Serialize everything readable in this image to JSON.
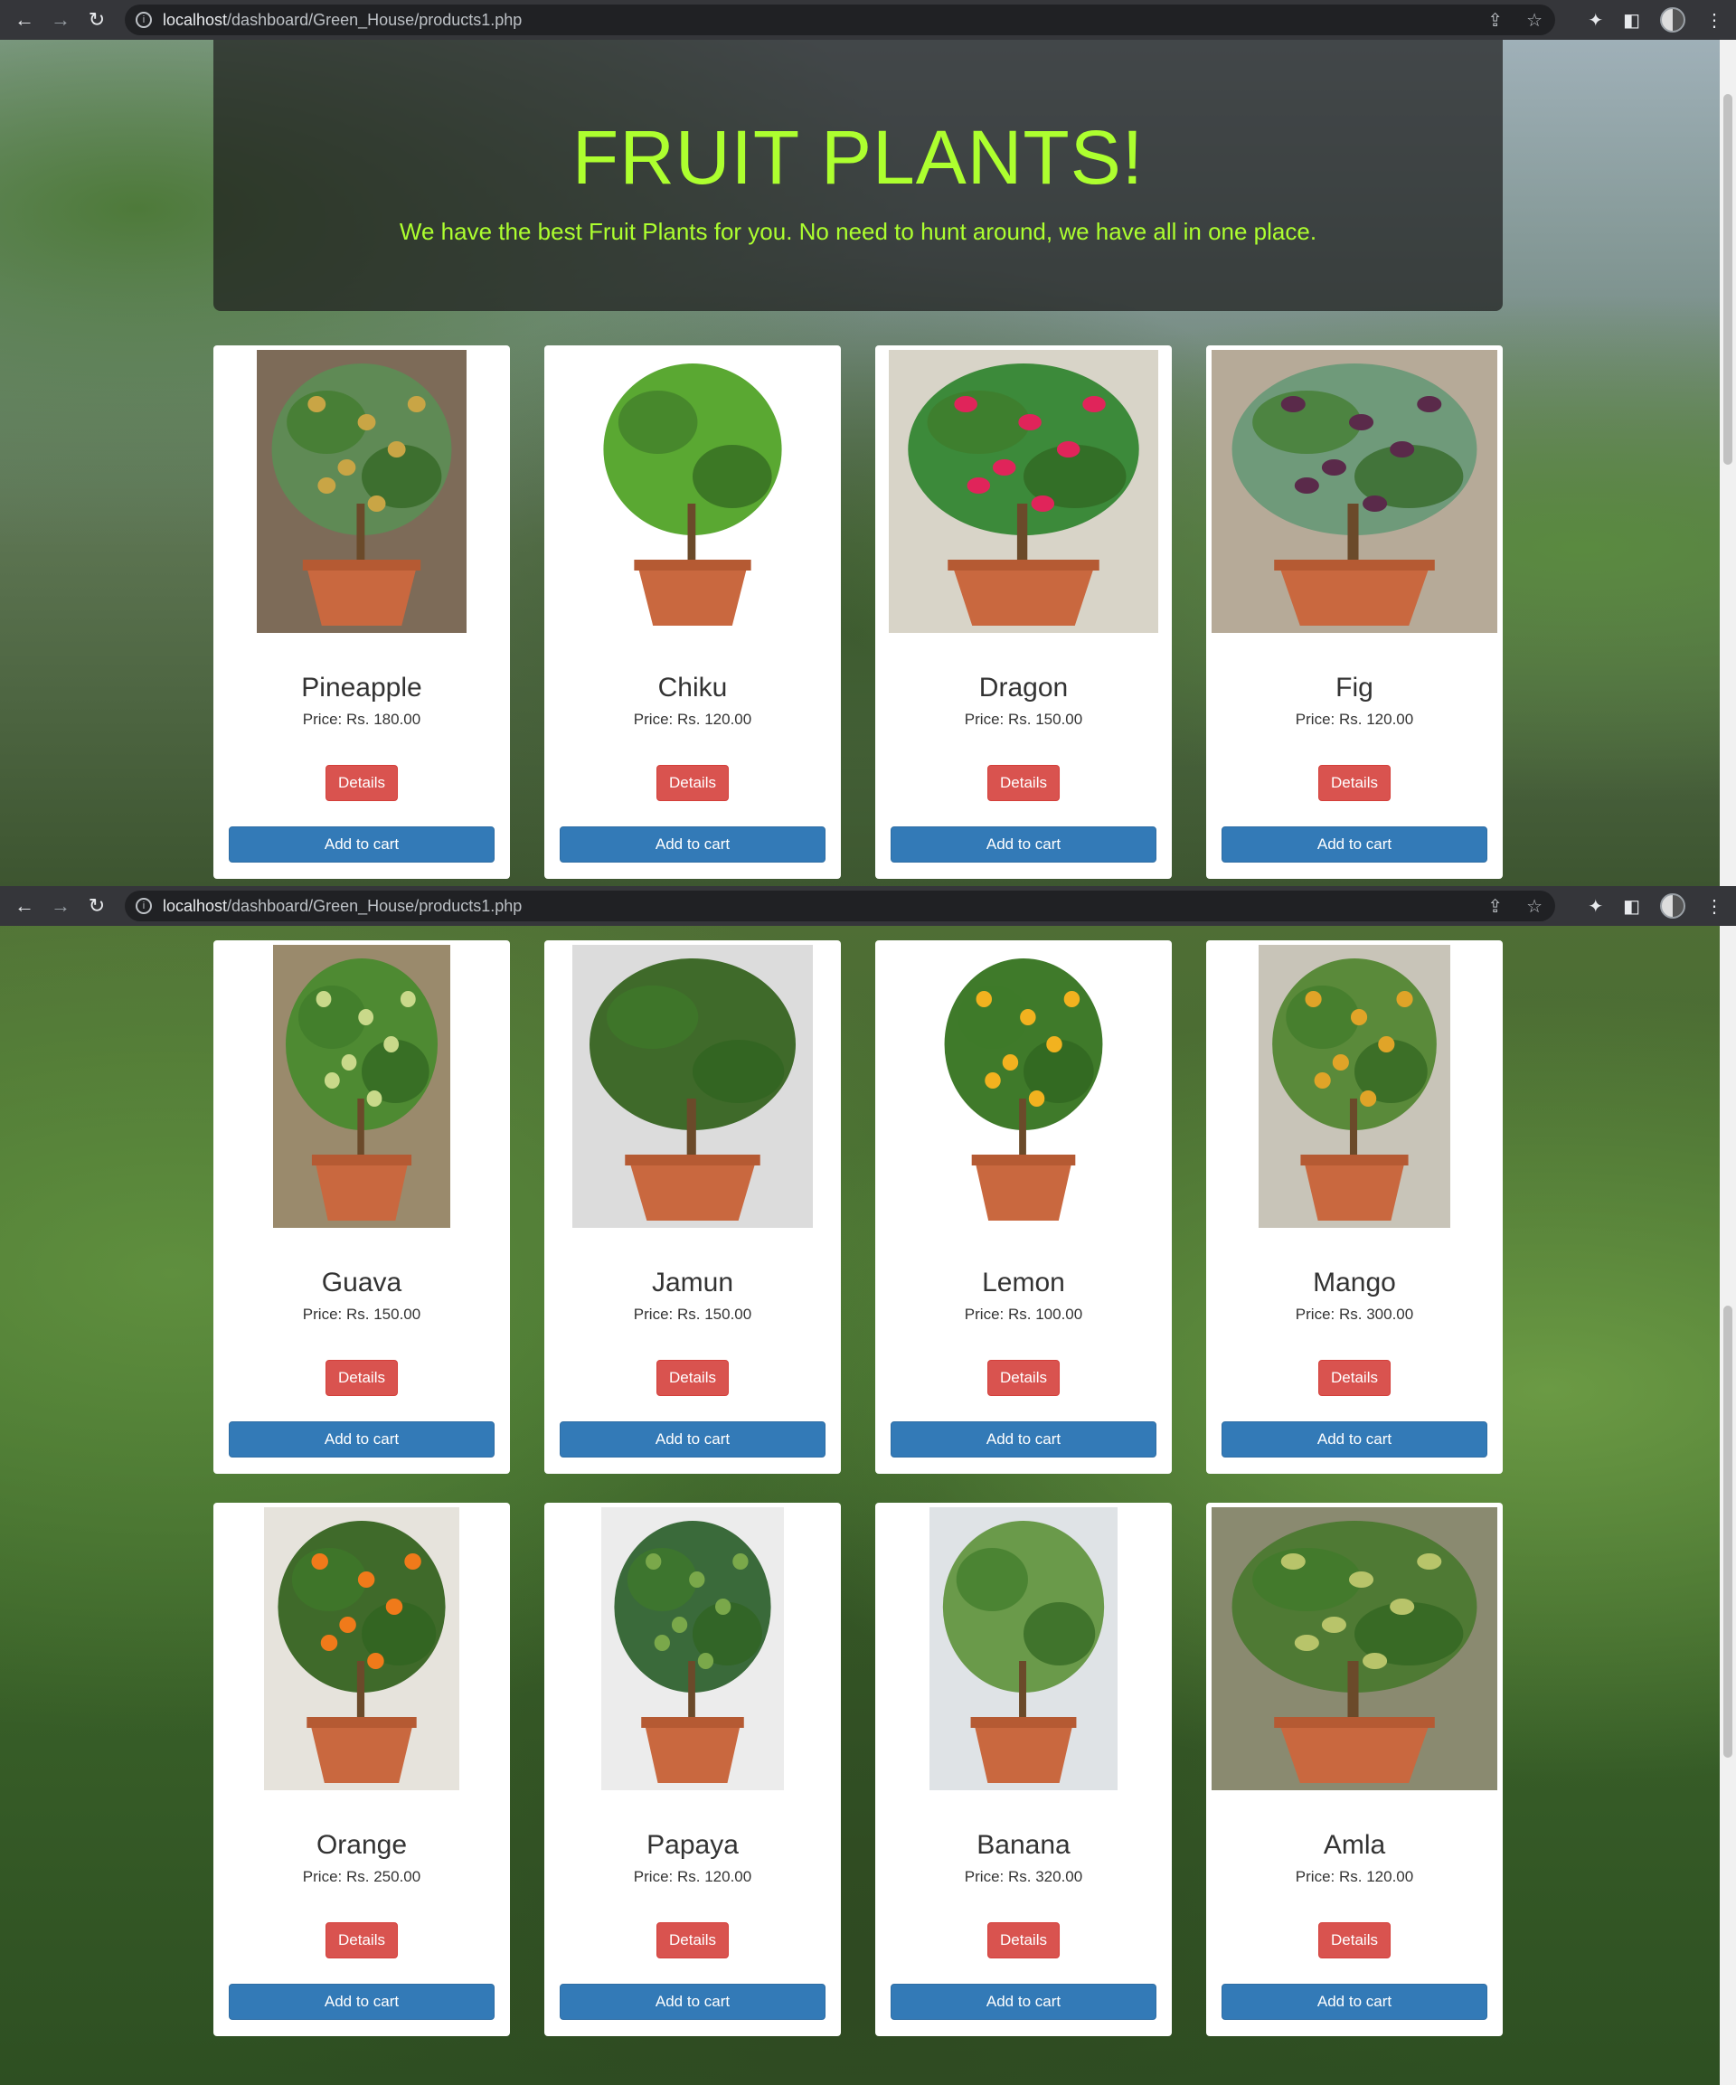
{
  "browser": {
    "url_host": "localhost",
    "url_path": "/dashboard/Green_House/products1.php"
  },
  "hero": {
    "title": "FRUIT PLANTS!",
    "subtitle": "We have the best Fruit Plants for you. No need to hunt around, we have all in one place."
  },
  "labels": {
    "price_prefix": "Price: Rs. ",
    "details": "Details",
    "add_to_cart": "Add to cart"
  },
  "products": [
    {
      "name": "Pineapple",
      "price": "180.00"
    },
    {
      "name": "Chiku",
      "price": "120.00"
    },
    {
      "name": "Dragon",
      "price": "150.00"
    },
    {
      "name": "Fig",
      "price": "120.00"
    },
    {
      "name": "Guava",
      "price": "150.00"
    },
    {
      "name": "Jamun",
      "price": "150.00"
    },
    {
      "name": "Lemon",
      "price": "100.00"
    },
    {
      "name": "Mango",
      "price": "300.00"
    },
    {
      "name": "Orange",
      "price": "250.00"
    },
    {
      "name": "Papaya",
      "price": "120.00"
    },
    {
      "name": "Banana",
      "price": "320.00"
    },
    {
      "name": "Amla",
      "price": "120.00"
    }
  ],
  "colors": {
    "hero_text": "#adff2f",
    "details_button": "#d9534f",
    "cart_button": "#337ab7"
  },
  "icons": [
    "back-icon",
    "forward-icon",
    "reload-icon",
    "info-icon",
    "share-icon",
    "star-icon",
    "extensions-icon",
    "sidepanel-icon",
    "profile-avatar",
    "menu-icon"
  ]
}
